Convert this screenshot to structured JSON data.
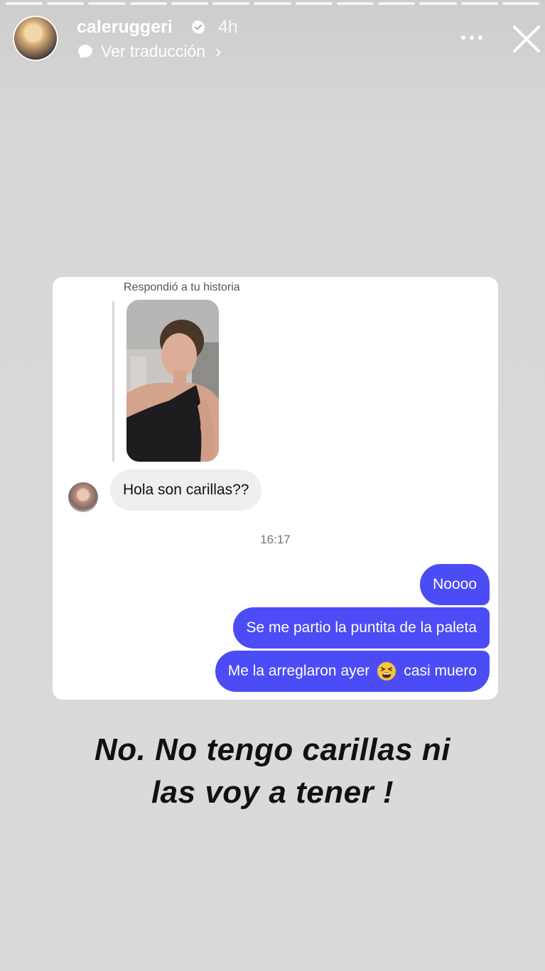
{
  "story": {
    "segments": 13,
    "username": "caleruggeri",
    "verified": true,
    "time": "4h",
    "translate_label": "Ver traducción",
    "icons": {
      "verified": "verified-badge-icon",
      "translate": "translate-icon",
      "more": "more-icon",
      "close": "close-icon"
    }
  },
  "chat": {
    "reply_label": "Respondió a tu historia",
    "incoming_message": "Hola son carillas??",
    "timestamp": "16:17",
    "outgoing_messages": [
      "Noooo",
      "Se me partio la puntita de la paleta"
    ],
    "last_message_before": "Me la arreglaron ayer",
    "last_message_after": "casi muero",
    "emoji": "weary-face",
    "colors": {
      "outgoing": "#4b4cf6",
      "incoming": "#efefef"
    }
  },
  "caption": {
    "line1": "No. No tengo carillas ni",
    "line2": "las voy a tener !"
  }
}
